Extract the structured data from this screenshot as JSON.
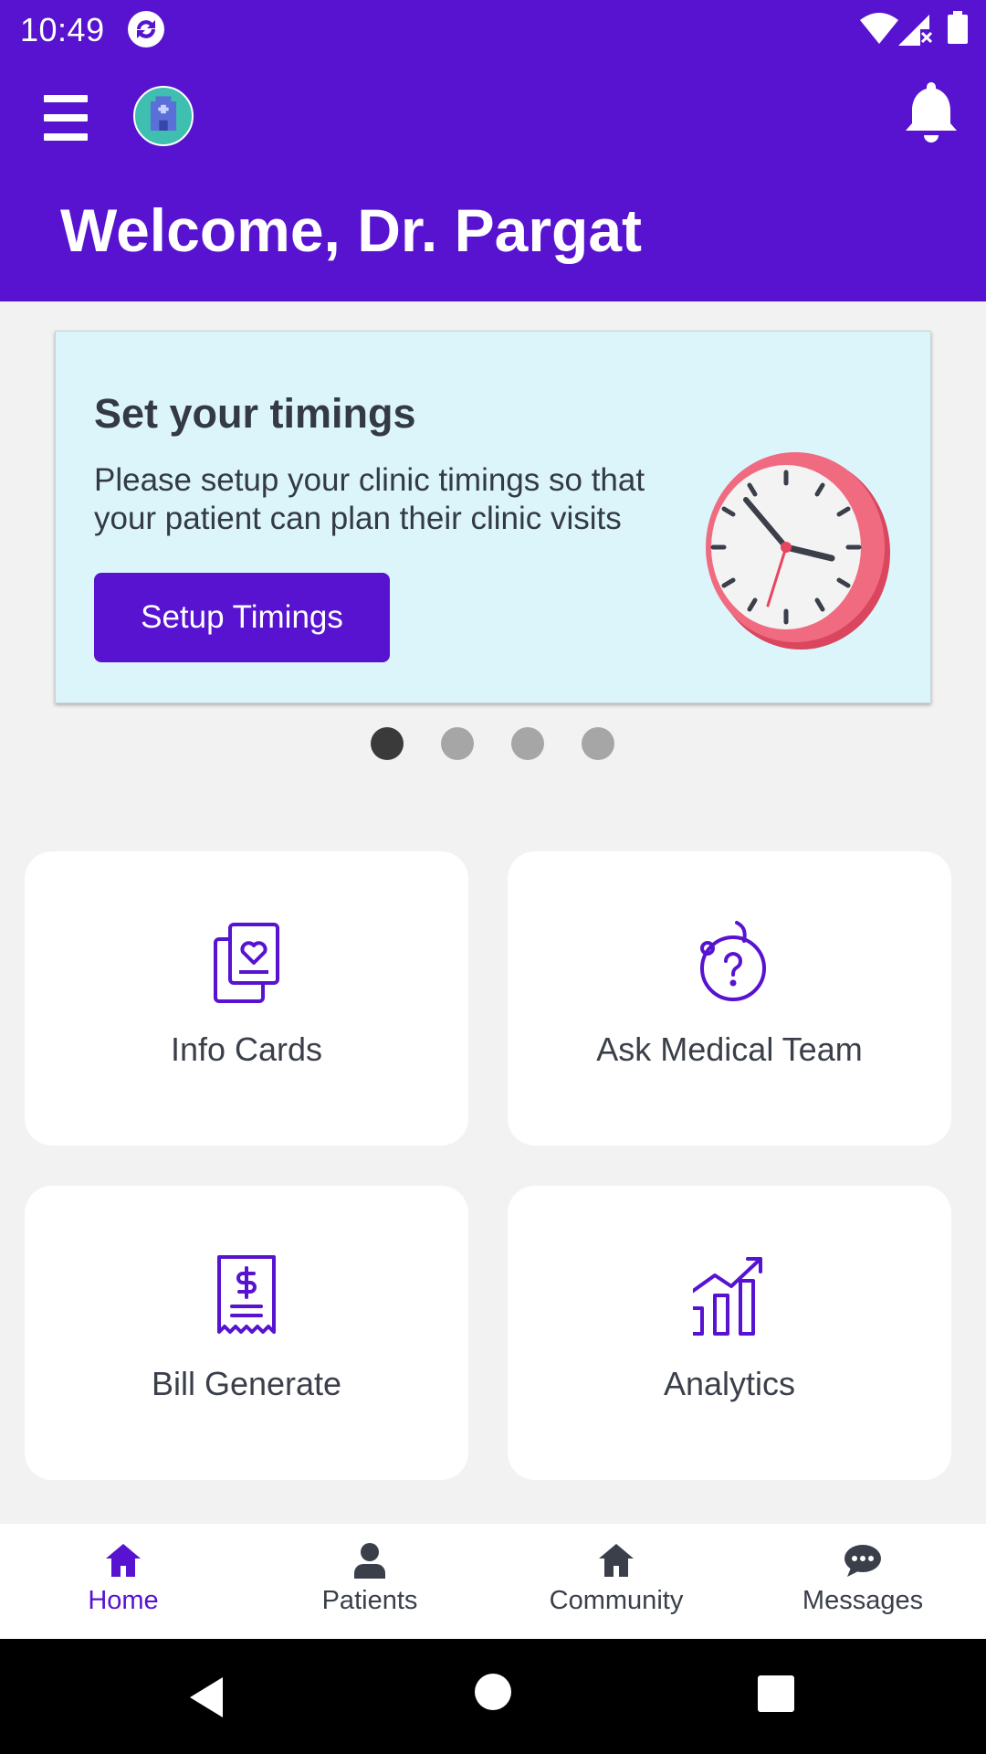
{
  "status_bar": {
    "time": "10:49",
    "icons": [
      "app-sync-icon",
      "wifi-icon",
      "signal-icon",
      "battery-icon"
    ]
  },
  "header": {
    "menu_icon": "hamburger-menu-icon",
    "avatar_icon": "clinic-building-icon",
    "notification_icon": "bell-icon",
    "welcome_text": "Welcome, Dr. Pargat"
  },
  "banner": {
    "title": "Set your timings",
    "text": "Please setup your clinic timings so that your patient can plan their clinic visits",
    "button_label": "Setup Timings",
    "illustration": "clock-icon",
    "pages": 4,
    "active_page": 1
  },
  "tiles": [
    {
      "label": "Info Cards",
      "icon": "info-cards-icon"
    },
    {
      "label": "Ask Medical Team",
      "icon": "stethoscope-question-icon"
    },
    {
      "label": "Bill Generate",
      "icon": "bill-receipt-icon"
    },
    {
      "label": "Analytics",
      "icon": "analytics-chart-icon"
    }
  ],
  "bottom_nav": [
    {
      "label": "Home",
      "icon": "home-icon",
      "active": true
    },
    {
      "label": "Patients",
      "icon": "person-icon",
      "active": false
    },
    {
      "label": "Community",
      "icon": "home-icon",
      "active": false
    },
    {
      "label": "Messages",
      "icon": "chat-bubble-icon",
      "active": false
    }
  ],
  "colors": {
    "primary": "#5713d0",
    "banner_bg": "#dcf5fb",
    "text_dark": "#3a3f4a",
    "page_bg": "#f2f2f2",
    "dot_active": "#3a3a3a",
    "dot_inactive": "#a6a6a6"
  }
}
